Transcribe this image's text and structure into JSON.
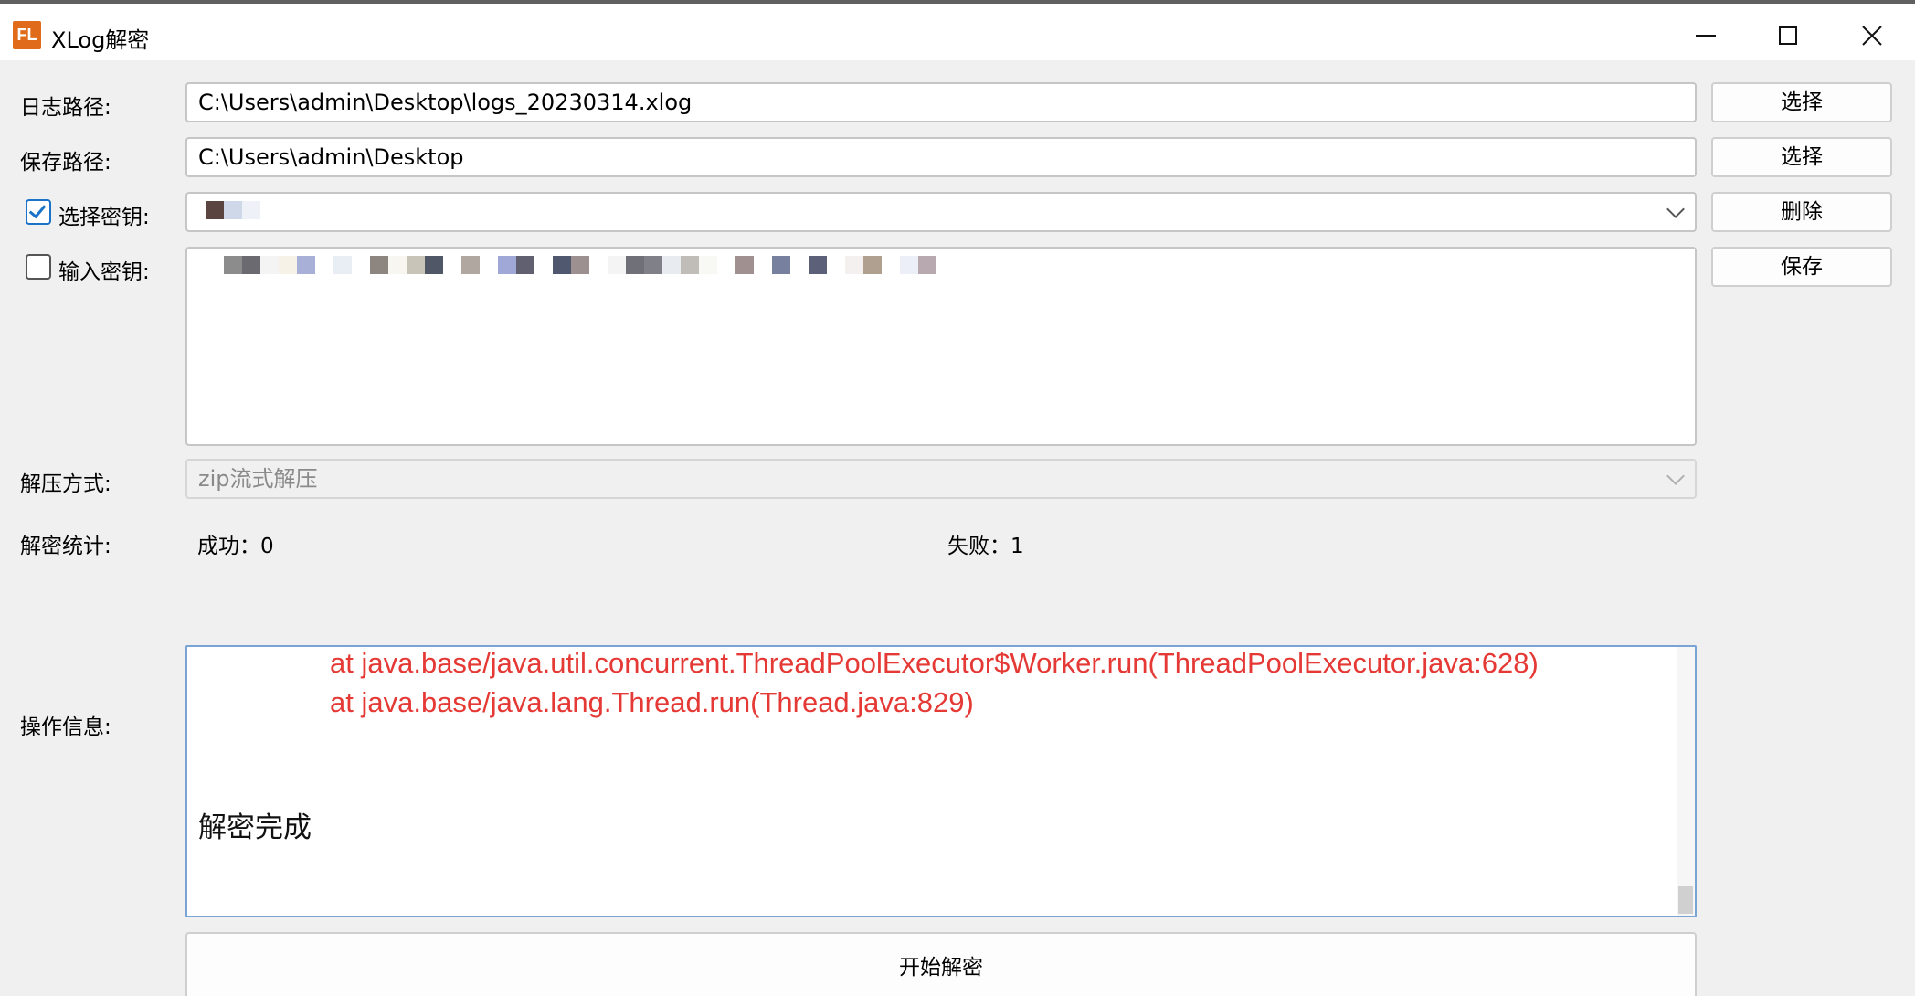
{
  "window": {
    "title": "XLog解密",
    "icon_text": "FL"
  },
  "log_path": {
    "label": "日志路径:",
    "value": "C:\\Users\\admin\\Desktop\\logs_20230314.xlog",
    "button": "选择"
  },
  "save_path": {
    "label": "保存路径:",
    "value": "C:\\Users\\admin\\Desktop",
    "button": "选择"
  },
  "select_key": {
    "label": "选择密钥:",
    "checked": true,
    "button": "删除"
  },
  "input_key": {
    "label": "输入密钥:",
    "checked": false,
    "button": "保存"
  },
  "decompress": {
    "label": "解压方式:",
    "value": "zip流式解压"
  },
  "stats": {
    "label": "解密统计:",
    "success": "成功：0",
    "failure": "失败：1"
  },
  "log": {
    "label": "操作信息:",
    "lines": [
      "at java.base/java.util.concurrent.ThreadPoolExecutor$Worker.run(ThreadPoolExecutor.java:628)",
      "at java.base/java.lang.Thread.run(Thread.java:829)"
    ],
    "done": "解密完成",
    "error_color": "#e53935"
  },
  "start_button": "开始解密"
}
